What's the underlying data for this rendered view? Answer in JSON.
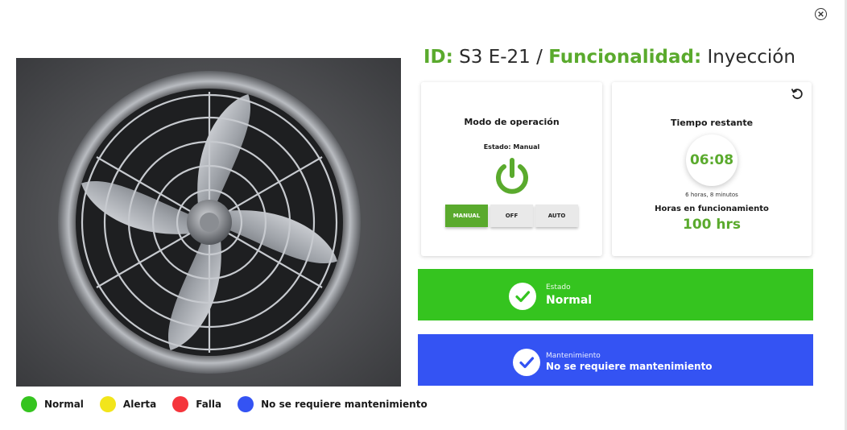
{
  "title": {
    "id_label": "ID:",
    "id_value": "S3 E-21",
    "separator": "/",
    "func_label": "Funcionalidad:",
    "func_value": "Inyección"
  },
  "mode_card": {
    "title": "Modo de operación",
    "state": "Estado: Manual",
    "buttons": [
      "MANUAL",
      "OFF",
      "AUTO"
    ],
    "active_button": "MANUAL"
  },
  "time_card": {
    "title": "Tiempo restante",
    "value": "06:08",
    "detail": "6 horas, 8 minutos",
    "hours_title": "Horas en funcionamiento",
    "hours_value": "100 hrs"
  },
  "status_banner": {
    "label": "Estado",
    "value": "Normal",
    "color": "#35c41f"
  },
  "maintenance_banner": {
    "label": "Mantenimiento",
    "value": "No se requiere mantenimiento",
    "color": "#3453f3"
  },
  "legend": [
    {
      "label": "Normal",
      "color": "#35c41f"
    },
    {
      "label": "Alerta",
      "color": "#f2e51b"
    },
    {
      "label": "Falla",
      "color": "#f5353c"
    },
    {
      "label": "No se requiere mantenimiento",
      "color": "#3453f3"
    }
  ],
  "icons": {
    "close": "close-icon",
    "refresh": "refresh-icon",
    "power": "power-icon",
    "check": "check-icon"
  },
  "accent_color": "#5aaa2d"
}
